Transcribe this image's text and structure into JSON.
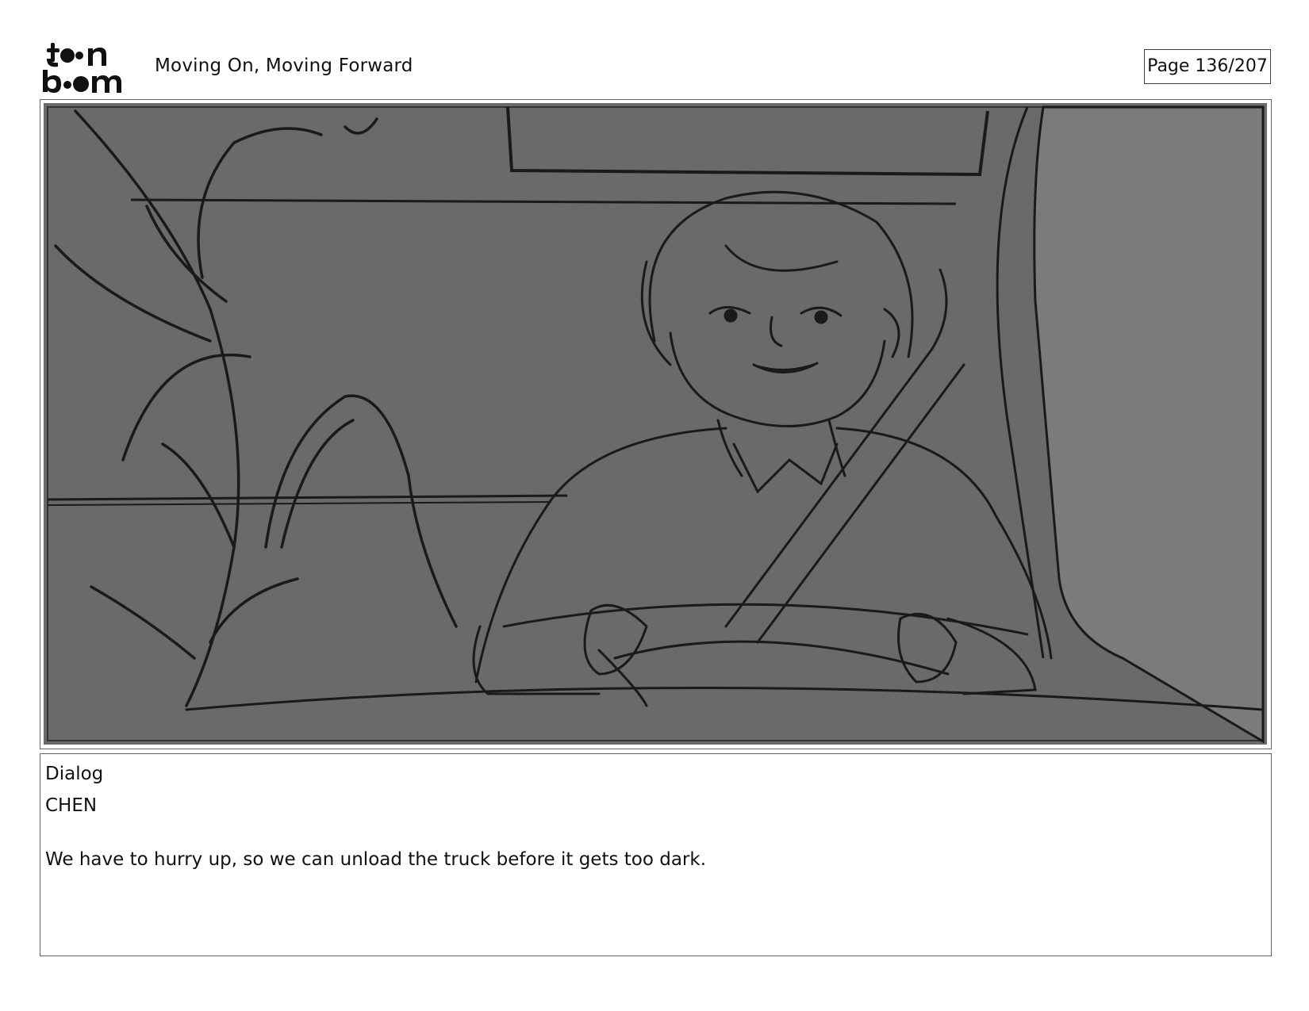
{
  "header": {
    "logo_text": "toon boom",
    "document_title": "Moving On, Moving Forward",
    "page_label": "Page 136/207"
  },
  "panel": {
    "image_alt": "Storyboard sketch: smiling older woman with short hair wearing a seatbelt and gripping a steering wheel inside a vehicle, tall plant in the foreground"
  },
  "dialog": {
    "heading": "Dialog",
    "character": "CHEN",
    "line": "We have to hurry up, so we can unload the truck before it gets too dark."
  },
  "colors": {
    "panel_background": "#6a6a6a",
    "sketch_line": "#1a1a1a",
    "border": "#666666"
  }
}
